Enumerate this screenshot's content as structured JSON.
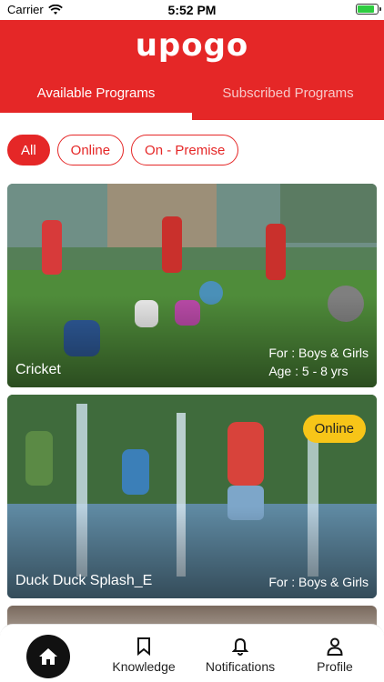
{
  "status_bar": {
    "carrier": "Carrier",
    "time": "5:52 PM"
  },
  "header": {
    "logo": "upogo"
  },
  "tabs": [
    {
      "label": "Available Programs",
      "active": true
    },
    {
      "label": "Subscribed Programs",
      "active": false
    }
  ],
  "filters": [
    {
      "label": "All",
      "active": true
    },
    {
      "label": "Online",
      "active": false
    },
    {
      "label": "On - Premise",
      "active": false
    }
  ],
  "programs": [
    {
      "title": "Cricket",
      "for": "For : Boys & Girls",
      "age": "Age : 5 - 8 yrs"
    },
    {
      "title": "Duck Duck Splash_E",
      "for": "For : Boys & Girls",
      "badge": "Online"
    }
  ],
  "bottom_nav": {
    "home_icon": "home-icon",
    "items": [
      {
        "label": "Knowledge",
        "icon": "bookmark-icon"
      },
      {
        "label": "Notifications",
        "icon": "bell-icon"
      },
      {
        "label": "Profile",
        "icon": "user-icon"
      }
    ]
  },
  "colors": {
    "brand": "#e52727",
    "badge": "#f7c518",
    "nav_home": "#111111"
  }
}
